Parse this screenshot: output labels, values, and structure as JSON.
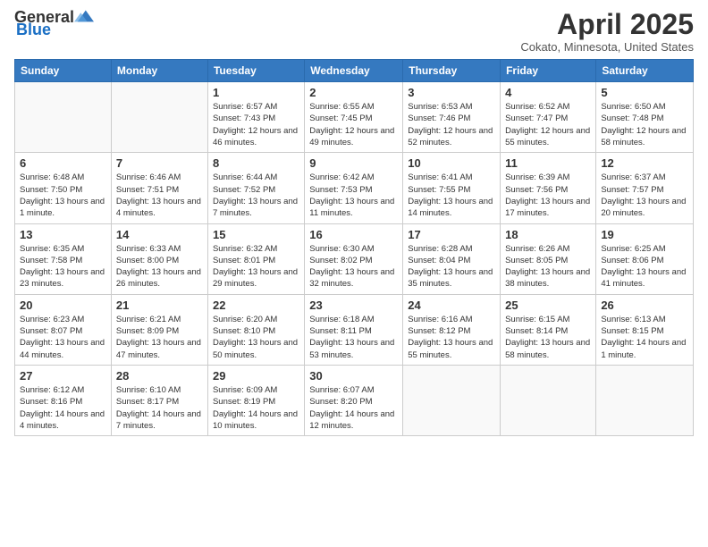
{
  "logo": {
    "general": "General",
    "blue": "Blue"
  },
  "header": {
    "title": "April 2025",
    "subtitle": "Cokato, Minnesota, United States"
  },
  "weekdays": [
    "Sunday",
    "Monday",
    "Tuesday",
    "Wednesday",
    "Thursday",
    "Friday",
    "Saturday"
  ],
  "weeks": [
    [
      {
        "day": null
      },
      {
        "day": null
      },
      {
        "day": "1",
        "sunrise": "Sunrise: 6:57 AM",
        "sunset": "Sunset: 7:43 PM",
        "daylight": "Daylight: 12 hours and 46 minutes."
      },
      {
        "day": "2",
        "sunrise": "Sunrise: 6:55 AM",
        "sunset": "Sunset: 7:45 PM",
        "daylight": "Daylight: 12 hours and 49 minutes."
      },
      {
        "day": "3",
        "sunrise": "Sunrise: 6:53 AM",
        "sunset": "Sunset: 7:46 PM",
        "daylight": "Daylight: 12 hours and 52 minutes."
      },
      {
        "day": "4",
        "sunrise": "Sunrise: 6:52 AM",
        "sunset": "Sunset: 7:47 PM",
        "daylight": "Daylight: 12 hours and 55 minutes."
      },
      {
        "day": "5",
        "sunrise": "Sunrise: 6:50 AM",
        "sunset": "Sunset: 7:48 PM",
        "daylight": "Daylight: 12 hours and 58 minutes."
      }
    ],
    [
      {
        "day": "6",
        "sunrise": "Sunrise: 6:48 AM",
        "sunset": "Sunset: 7:50 PM",
        "daylight": "Daylight: 13 hours and 1 minute."
      },
      {
        "day": "7",
        "sunrise": "Sunrise: 6:46 AM",
        "sunset": "Sunset: 7:51 PM",
        "daylight": "Daylight: 13 hours and 4 minutes."
      },
      {
        "day": "8",
        "sunrise": "Sunrise: 6:44 AM",
        "sunset": "Sunset: 7:52 PM",
        "daylight": "Daylight: 13 hours and 7 minutes."
      },
      {
        "day": "9",
        "sunrise": "Sunrise: 6:42 AM",
        "sunset": "Sunset: 7:53 PM",
        "daylight": "Daylight: 13 hours and 11 minutes."
      },
      {
        "day": "10",
        "sunrise": "Sunrise: 6:41 AM",
        "sunset": "Sunset: 7:55 PM",
        "daylight": "Daylight: 13 hours and 14 minutes."
      },
      {
        "day": "11",
        "sunrise": "Sunrise: 6:39 AM",
        "sunset": "Sunset: 7:56 PM",
        "daylight": "Daylight: 13 hours and 17 minutes."
      },
      {
        "day": "12",
        "sunrise": "Sunrise: 6:37 AM",
        "sunset": "Sunset: 7:57 PM",
        "daylight": "Daylight: 13 hours and 20 minutes."
      }
    ],
    [
      {
        "day": "13",
        "sunrise": "Sunrise: 6:35 AM",
        "sunset": "Sunset: 7:58 PM",
        "daylight": "Daylight: 13 hours and 23 minutes."
      },
      {
        "day": "14",
        "sunrise": "Sunrise: 6:33 AM",
        "sunset": "Sunset: 8:00 PM",
        "daylight": "Daylight: 13 hours and 26 minutes."
      },
      {
        "day": "15",
        "sunrise": "Sunrise: 6:32 AM",
        "sunset": "Sunset: 8:01 PM",
        "daylight": "Daylight: 13 hours and 29 minutes."
      },
      {
        "day": "16",
        "sunrise": "Sunrise: 6:30 AM",
        "sunset": "Sunset: 8:02 PM",
        "daylight": "Daylight: 13 hours and 32 minutes."
      },
      {
        "day": "17",
        "sunrise": "Sunrise: 6:28 AM",
        "sunset": "Sunset: 8:04 PM",
        "daylight": "Daylight: 13 hours and 35 minutes."
      },
      {
        "day": "18",
        "sunrise": "Sunrise: 6:26 AM",
        "sunset": "Sunset: 8:05 PM",
        "daylight": "Daylight: 13 hours and 38 minutes."
      },
      {
        "day": "19",
        "sunrise": "Sunrise: 6:25 AM",
        "sunset": "Sunset: 8:06 PM",
        "daylight": "Daylight: 13 hours and 41 minutes."
      }
    ],
    [
      {
        "day": "20",
        "sunrise": "Sunrise: 6:23 AM",
        "sunset": "Sunset: 8:07 PM",
        "daylight": "Daylight: 13 hours and 44 minutes."
      },
      {
        "day": "21",
        "sunrise": "Sunrise: 6:21 AM",
        "sunset": "Sunset: 8:09 PM",
        "daylight": "Daylight: 13 hours and 47 minutes."
      },
      {
        "day": "22",
        "sunrise": "Sunrise: 6:20 AM",
        "sunset": "Sunset: 8:10 PM",
        "daylight": "Daylight: 13 hours and 50 minutes."
      },
      {
        "day": "23",
        "sunrise": "Sunrise: 6:18 AM",
        "sunset": "Sunset: 8:11 PM",
        "daylight": "Daylight: 13 hours and 53 minutes."
      },
      {
        "day": "24",
        "sunrise": "Sunrise: 6:16 AM",
        "sunset": "Sunset: 8:12 PM",
        "daylight": "Daylight: 13 hours and 55 minutes."
      },
      {
        "day": "25",
        "sunrise": "Sunrise: 6:15 AM",
        "sunset": "Sunset: 8:14 PM",
        "daylight": "Daylight: 13 hours and 58 minutes."
      },
      {
        "day": "26",
        "sunrise": "Sunrise: 6:13 AM",
        "sunset": "Sunset: 8:15 PM",
        "daylight": "Daylight: 14 hours and 1 minute."
      }
    ],
    [
      {
        "day": "27",
        "sunrise": "Sunrise: 6:12 AM",
        "sunset": "Sunset: 8:16 PM",
        "daylight": "Daylight: 14 hours and 4 minutes."
      },
      {
        "day": "28",
        "sunrise": "Sunrise: 6:10 AM",
        "sunset": "Sunset: 8:17 PM",
        "daylight": "Daylight: 14 hours and 7 minutes."
      },
      {
        "day": "29",
        "sunrise": "Sunrise: 6:09 AM",
        "sunset": "Sunset: 8:19 PM",
        "daylight": "Daylight: 14 hours and 10 minutes."
      },
      {
        "day": "30",
        "sunrise": "Sunrise: 6:07 AM",
        "sunset": "Sunset: 8:20 PM",
        "daylight": "Daylight: 14 hours and 12 minutes."
      },
      {
        "day": null
      },
      {
        "day": null
      },
      {
        "day": null
      }
    ]
  ]
}
